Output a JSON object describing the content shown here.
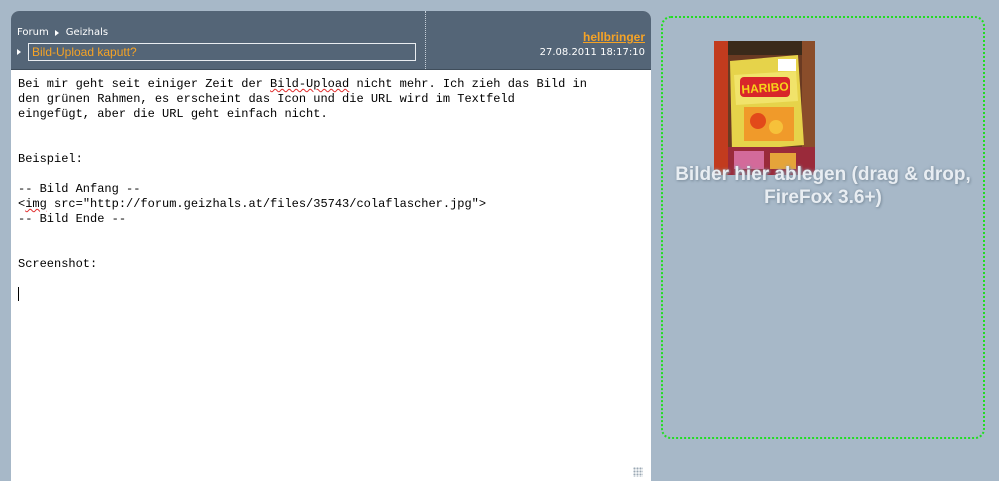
{
  "breadcrumb": {
    "root": "Forum",
    "section": "Geizhals"
  },
  "post": {
    "subject": "Bild-Upload kaputt?",
    "author": "hellbringer",
    "timestamp": "27.08.2011 18:17:10"
  },
  "editor": {
    "line1a": "Bei mir geht seit einiger Zeit der ",
    "line1_misspelled": "Bild-Upload",
    "line1b": " nicht mehr. Ich zieh das Bild in\nden grünen Rahmen, es erscheint das Icon und die URL wird im Textfeld\neingefügt, aber die URL geht einfach nicht.\n\n\nBeispiel:\n\n-- Bild Anfang --\n<",
    "img_misspelled": "img",
    "line_rest": " src=\"http://forum.geizhals.at/files/35743/colaflascher.jpg\">\n-- Bild Ende --\n\n\nScreenshot:\n"
  },
  "dropzone": {
    "label": "Bilder hier ablegen (drag & drop, FireFox 3.6+)",
    "border_color": "#22dd22"
  },
  "colors": {
    "header_bg": "#546577",
    "page_bg": "#a7b8c8",
    "accent": "#f5a326"
  }
}
